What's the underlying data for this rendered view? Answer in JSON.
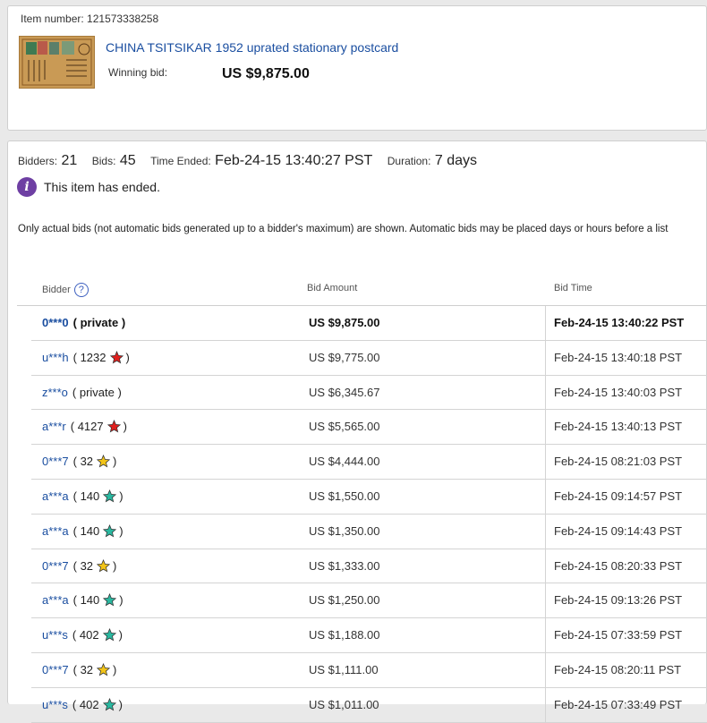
{
  "item": {
    "number_label": "Item number:",
    "number": "121573338258",
    "title": "CHINA TSITSIKAR 1952 uprated stationary postcard",
    "winning_bid_label": "Winning bid:",
    "winning_bid": "US $9,875.00"
  },
  "stats": {
    "bidders_label": "Bidders:",
    "bidders": "21",
    "bids_label": "Bids:",
    "bids": "45",
    "time_ended_label": "Time Ended:",
    "time_ended": "Feb-24-15 13:40:27 PST",
    "duration_label": "Duration:",
    "duration": "7 days"
  },
  "status_message": "This item has ended.",
  "note": "Only actual bids (not automatic bids generated up to a bidder's maximum) are shown. Automatic bids may be placed days or hours before a list",
  "columns": {
    "bidder": "Bidder",
    "help": "?",
    "amount": "Bid Amount",
    "time": "Bid Time"
  },
  "colors": {
    "link": "#1a4ea0",
    "info_icon": "#6e3fa3",
    "star_red": "#e0201e",
    "star_yellow": "#f2c418",
    "star_teal": "#2ab8a0"
  },
  "bids": [
    {
      "bidder": "0***0",
      "feedback": "( private )",
      "star": "none",
      "amount": "US $9,875.00",
      "time": "Feb-24-15 13:40:22 PST",
      "top": true
    },
    {
      "bidder": "u***h",
      "feedback": "( 1232",
      "star": "red",
      "amount": "US $9,775.00",
      "time": "Feb-24-15 13:40:18 PST"
    },
    {
      "bidder": "z***o",
      "feedback": "( private )",
      "star": "none",
      "amount": "US $6,345.67",
      "time": "Feb-24-15 13:40:03 PST"
    },
    {
      "bidder": "a***r",
      "feedback": "( 4127",
      "star": "red",
      "amount": "US $5,565.00",
      "time": "Feb-24-15 13:40:13 PST"
    },
    {
      "bidder": "0***7",
      "feedback": "( 32",
      "star": "yellow",
      "amount": "US $4,444.00",
      "time": "Feb-24-15 08:21:03 PST"
    },
    {
      "bidder": "a***a",
      "feedback": "( 140",
      "star": "teal",
      "amount": "US $1,550.00",
      "time": "Feb-24-15 09:14:57 PST"
    },
    {
      "bidder": "a***a",
      "feedback": "( 140",
      "star": "teal",
      "amount": "US $1,350.00",
      "time": "Feb-24-15 09:14:43 PST"
    },
    {
      "bidder": "0***7",
      "feedback": "( 32",
      "star": "yellow",
      "amount": "US $1,333.00",
      "time": "Feb-24-15 08:20:33 PST"
    },
    {
      "bidder": "a***a",
      "feedback": "( 140",
      "star": "teal",
      "amount": "US $1,250.00",
      "time": "Feb-24-15 09:13:26 PST"
    },
    {
      "bidder": "u***s",
      "feedback": "( 402",
      "star": "teal",
      "amount": "US $1,188.00",
      "time": "Feb-24-15 07:33:59 PST"
    },
    {
      "bidder": "0***7",
      "feedback": "( 32",
      "star": "yellow",
      "amount": "US $1,111.00",
      "time": "Feb-24-15 08:20:11 PST"
    },
    {
      "bidder": "u***s",
      "feedback": "( 402",
      "star": "teal",
      "amount": "US $1,011.00",
      "time": "Feb-24-15 07:33:49 PST"
    }
  ]
}
